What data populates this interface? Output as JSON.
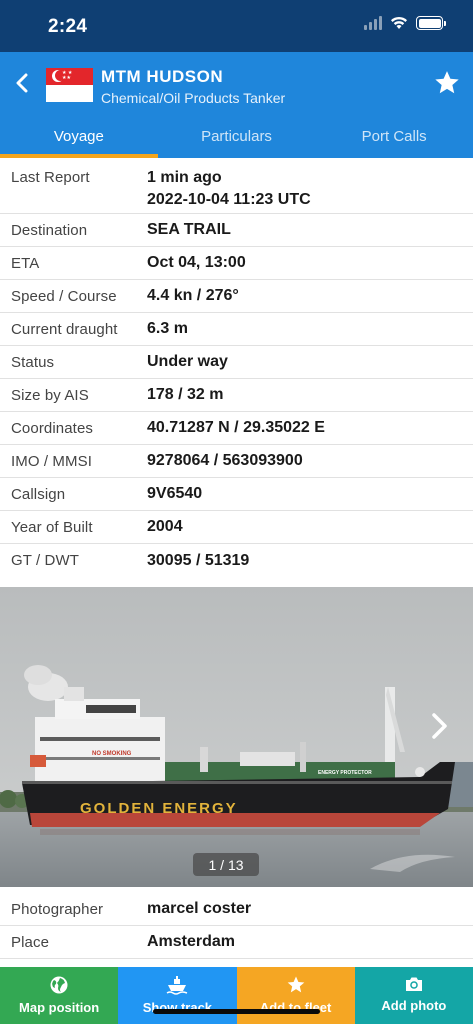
{
  "status_bar": {
    "time": "2:24"
  },
  "header": {
    "vessel_name": "MTM HUDSON",
    "vessel_type": "Chemical/Oil Products Tanker",
    "flag_icon": "singapore-flag-icon",
    "nav_color": "#1f86db",
    "status_color": "#0f3f73"
  },
  "tabs": [
    {
      "label": "Voyage",
      "active": true
    },
    {
      "label": "Particulars",
      "active": false
    },
    {
      "label": "Port Calls",
      "active": false
    }
  ],
  "accent_color": "#f4a51c",
  "details": {
    "last_report": {
      "label": "Last Report",
      "value": "1 min ago",
      "value2": "2022-10-04 11:23 UTC"
    },
    "destination": {
      "label": "Destination",
      "value": "SEA TRAIL"
    },
    "eta": {
      "label": "ETA",
      "value": "Oct 04, 13:00"
    },
    "speed_course": {
      "label": "Speed / Course",
      "value": "4.4 kn / 276°"
    },
    "draught": {
      "label": "Current draught",
      "value": "6.3 m"
    },
    "status": {
      "label": "Status",
      "value": "Under way"
    },
    "size": {
      "label": "Size by AIS",
      "value": "178 / 32 m"
    },
    "coordinates": {
      "label": "Coordinates",
      "value": "40.71287 N / 29.35022 E"
    },
    "imo_mmsi": {
      "label": "IMO / MMSI",
      "value": "9278064 / 563093900"
    },
    "callsign": {
      "label": "Callsign",
      "value": "9V6540"
    },
    "year_built": {
      "label": "Year of Built",
      "value": "2004"
    },
    "gt_dwt": {
      "label": "GT / DWT",
      "value": "30095 / 51319"
    }
  },
  "photo": {
    "counter": "1 / 13",
    "hull_text": "GOLDEN ENERGY",
    "bow_text": "ENERGY PROTECTOR",
    "deck_sign": "NO SMOKING"
  },
  "photo_meta": {
    "photographer": {
      "label": "Photographer",
      "value": "marcel coster"
    },
    "place": {
      "label": "Place",
      "value": "Amsterdam"
    }
  },
  "bottom_actions": [
    {
      "label": "Map position",
      "icon": "globe-icon",
      "color": "#33a853"
    },
    {
      "label": "Show track",
      "icon": "ship-icon",
      "color": "#2196f3"
    },
    {
      "label": "Add to fleet",
      "icon": "star-icon",
      "color": "#f5a623"
    },
    {
      "label": "Add photo",
      "icon": "camera-icon",
      "color": "#14a6a6"
    }
  ]
}
